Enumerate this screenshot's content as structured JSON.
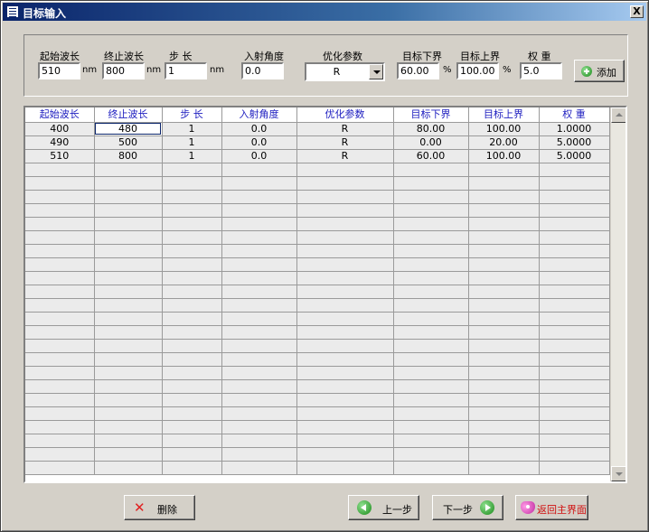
{
  "window": {
    "title": "目标输入",
    "close_label": "X"
  },
  "params": {
    "start_wave": {
      "label": "起始波长",
      "value": "510",
      "unit": "nm"
    },
    "end_wave": {
      "label": "终止波长",
      "value": "800",
      "unit": "nm"
    },
    "step": {
      "label": "步 长",
      "value": "1",
      "unit": "nm"
    },
    "angle": {
      "label": "入射角度",
      "value": "0.0"
    },
    "opt_param": {
      "label": "优化参数",
      "value": "R"
    },
    "lower": {
      "label": "目标下界",
      "value": "60.00",
      "unit": "%"
    },
    "upper": {
      "label": "目标上界",
      "value": "100.00",
      "unit": "%"
    },
    "weight": {
      "label": "权 重",
      "value": "5.0"
    },
    "add_label": "添加"
  },
  "table": {
    "headers": [
      "起始波长",
      "终止波长",
      "步 长",
      "入射角度",
      "优化参数",
      "目标下界",
      "目标上界",
      "权 重"
    ],
    "rows": [
      [
        "400",
        "480",
        "1",
        "0.0",
        "R",
        "80.00",
        "100.00",
        "1.0000"
      ],
      [
        "490",
        "500",
        "1",
        "0.0",
        "R",
        "0.00",
        "20.00",
        "5.0000"
      ],
      [
        "510",
        "800",
        "1",
        "0.0",
        "R",
        "60.00",
        "100.00",
        "5.0000"
      ]
    ]
  },
  "buttons": {
    "delete": "删除",
    "prev": "上一步",
    "next": "下一步",
    "home": "返回主界面"
  },
  "colors": {
    "header_text": "#2020c0",
    "title_bar": "#0a246a",
    "home_text": "#d01010"
  }
}
